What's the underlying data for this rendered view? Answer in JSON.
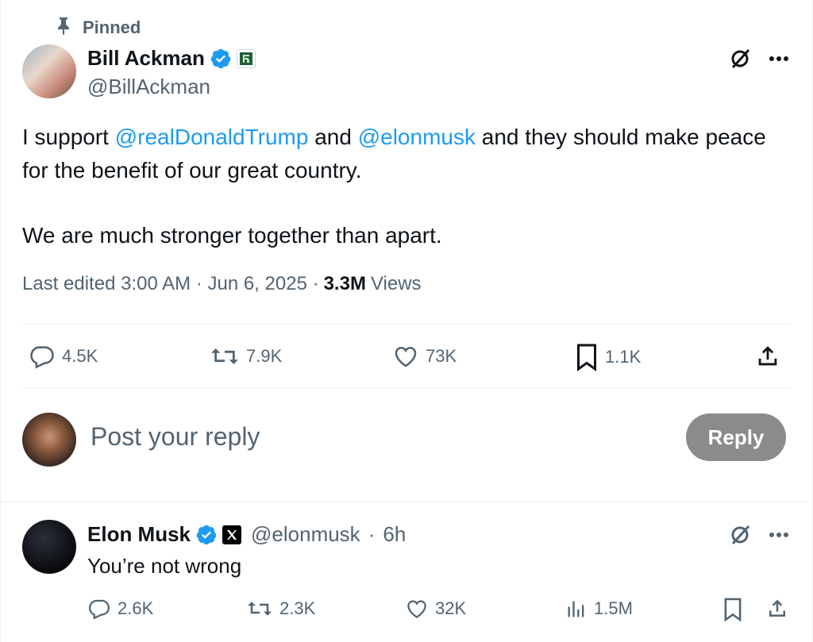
{
  "pinned": {
    "label": "Pinned",
    "icon": "pin-icon"
  },
  "tweet": {
    "author": {
      "name": "Bill Ackman",
      "handle": "@BillAckman",
      "verified_icon": "verified-badge-icon",
      "affiliate_icon": "affiliate-badge-icon"
    },
    "text": {
      "p1_part1": "I support ",
      "mention1": "@realDonaldTrump",
      "p1_part2": " and ",
      "mention2": "@elonmusk",
      "p1_part3": " and they should make peace for the benefit of our great country.",
      "p2": "We are much stronger together than apart."
    },
    "meta": {
      "edited": "Last edited 3:00 AM · Jun 6, 2025 ·",
      "views_count": "3.3M",
      "views_label": "Views"
    },
    "actions": {
      "replies": "4.5K",
      "reposts": "7.9K",
      "likes": "73K",
      "bookmarks": "1.1K"
    }
  },
  "composer": {
    "placeholder": "Post your reply",
    "reply_button": "Reply"
  },
  "reply": {
    "author": {
      "name": "Elon Musk",
      "handle": "@elonmusk",
      "time": "6h",
      "sep": "·"
    },
    "text": "You’re not wrong",
    "actions": {
      "replies": "2.6K",
      "reposts": "2.3K",
      "likes": "32K",
      "views": "1.5M"
    }
  },
  "colors": {
    "accent": "#1d9bf0",
    "text": "#0f1419",
    "muted": "#536471",
    "button_disabled": "#8b8b8b"
  }
}
